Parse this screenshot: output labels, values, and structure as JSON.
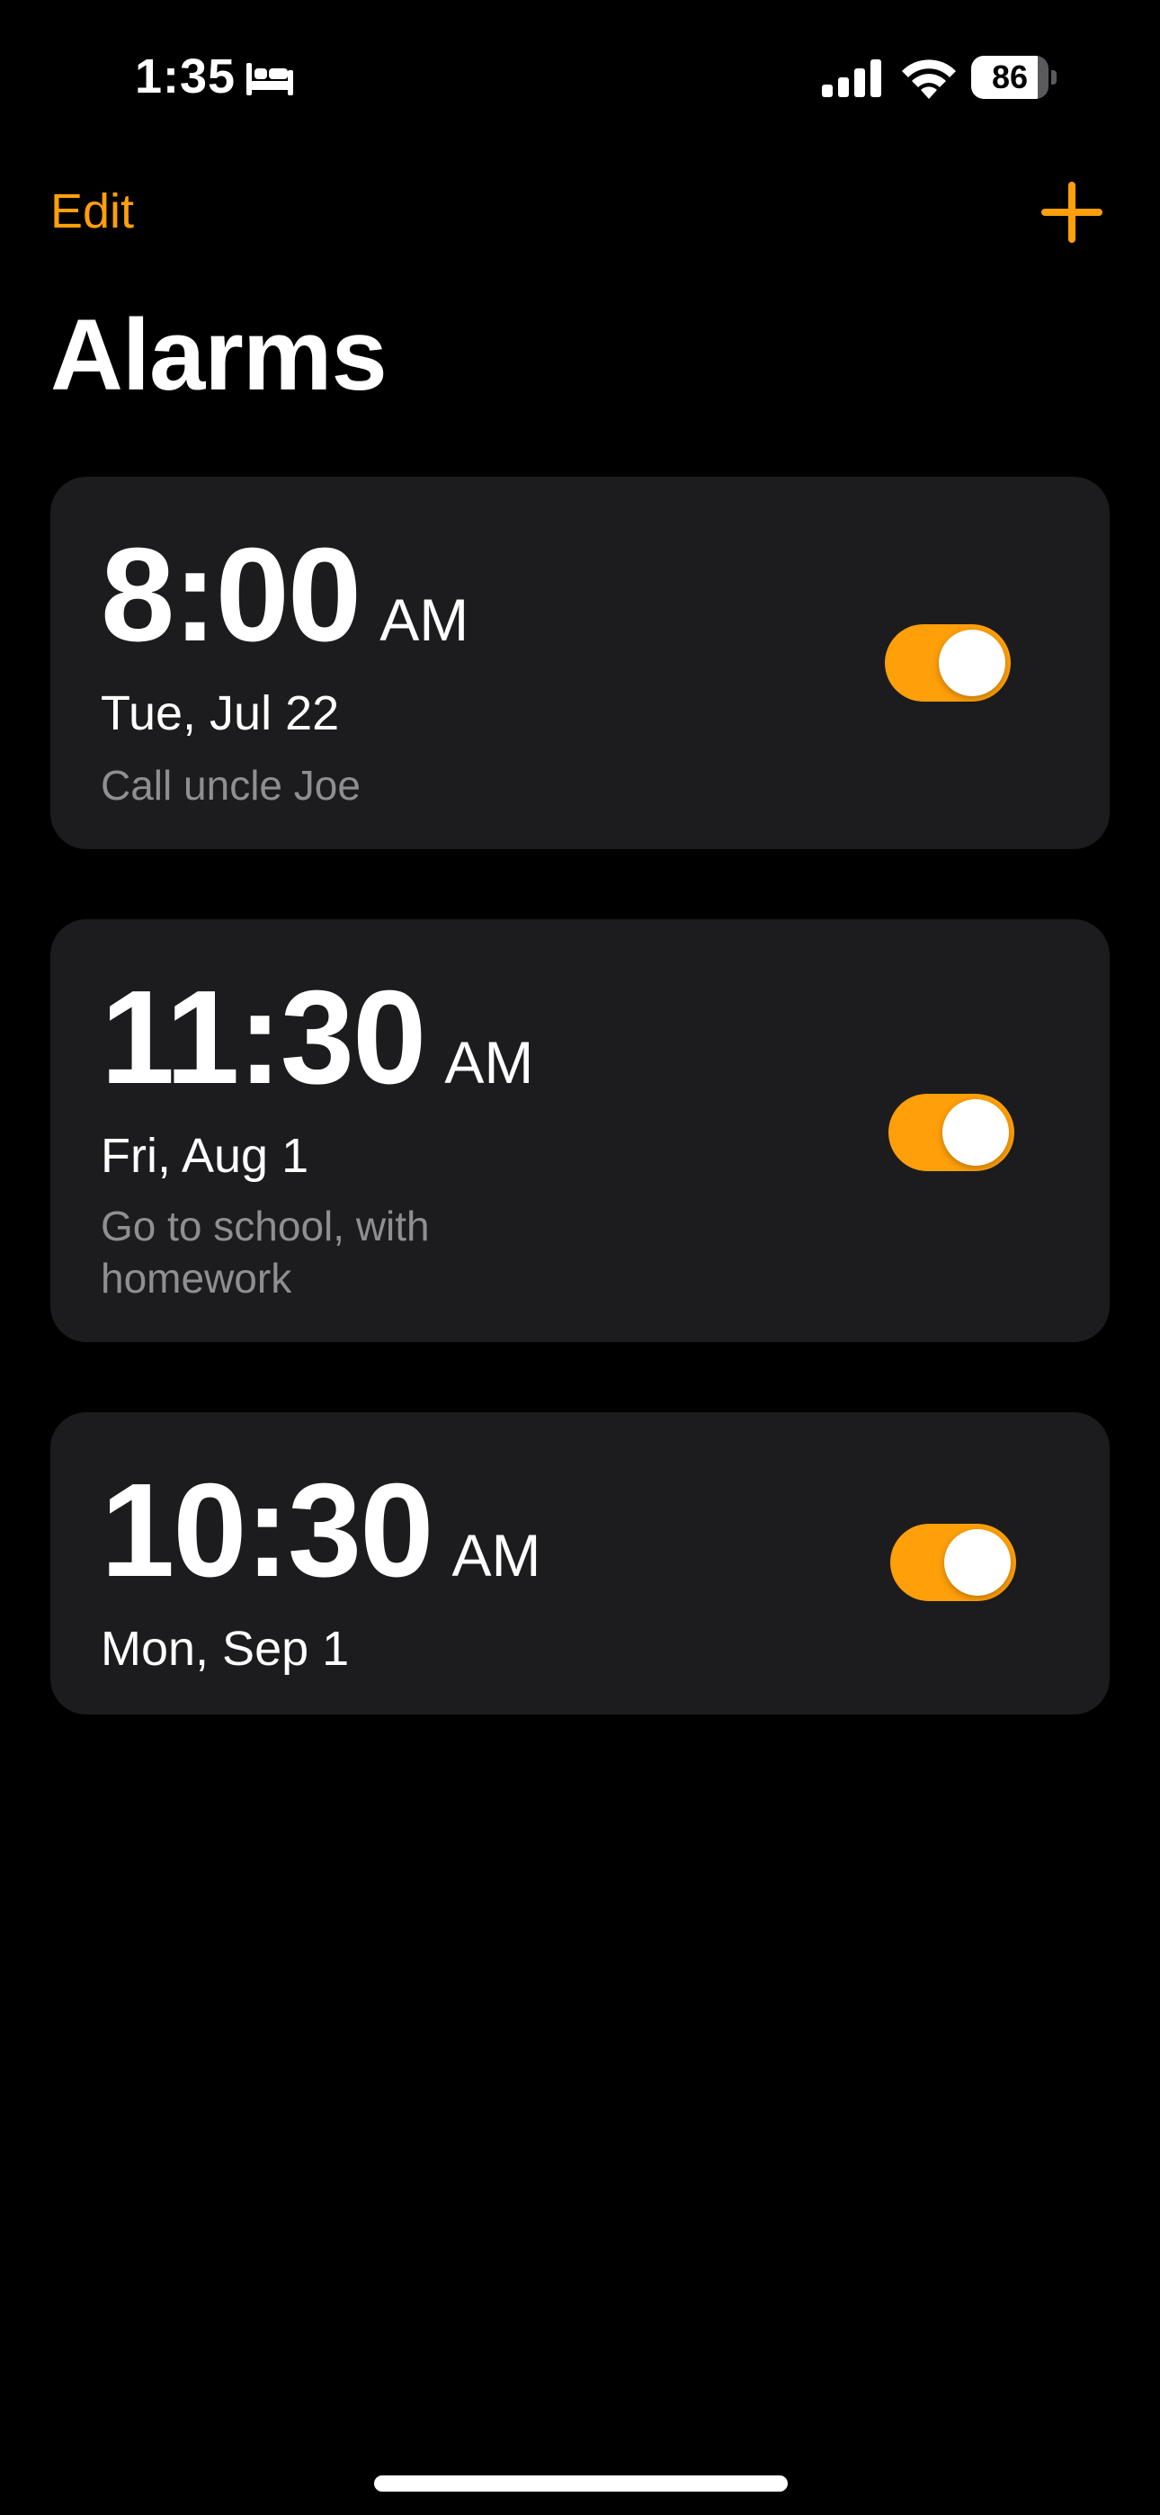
{
  "status_bar": {
    "time": "1:35",
    "battery": "86",
    "icons": [
      "bed-icon",
      "cellular-signal-icon",
      "wifi-icon",
      "battery-icon"
    ]
  },
  "nav": {
    "edit_label": "Edit",
    "add_icon": "plus-icon"
  },
  "title": "Alarms",
  "alarms": [
    {
      "time": "8:00",
      "period": "AM",
      "date": "Tue, Jul 22",
      "label": "Call uncle Joe",
      "enabled": true
    },
    {
      "time": "11:30",
      "period": "AM",
      "date": "Fri, Aug 1",
      "label": "Go to school, with homework",
      "enabled": true
    },
    {
      "time": "10:30",
      "period": "AM",
      "date": "Mon, Sep 1",
      "label": "",
      "enabled": true
    }
  ],
  "colors": {
    "accent": "#ff9f0a",
    "background": "#000000",
    "card": "#1c1c1e",
    "secondary_text": "#8e8e93"
  }
}
